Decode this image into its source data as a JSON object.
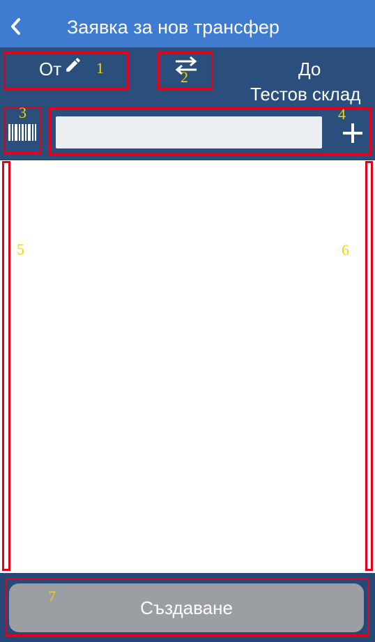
{
  "appbar": {
    "title": "Заявка за нов трансфер",
    "back_icon": "chevron-left-icon"
  },
  "transfer": {
    "from_label": "От",
    "edit_icon": "pencil-icon",
    "swap_icon": "swap-arrows-icon",
    "to_label": "До",
    "to_value": "Тестов склад"
  },
  "search": {
    "value": "",
    "barcode_icon": "barcode-icon",
    "add_icon": "plus-icon"
  },
  "items": [],
  "footer": {
    "create_label": "Създаване"
  },
  "annotations": [
    "1",
    "2",
    "3",
    "4",
    "5",
    "6",
    "7"
  ],
  "colors": {
    "appbar": "#3f7bd0",
    "band": "#2a4f7d",
    "input": "#eceff1",
    "button_disabled": "#9b9ea3",
    "annotation_box": "#e3001b",
    "annotation_number": "#f4d300"
  }
}
